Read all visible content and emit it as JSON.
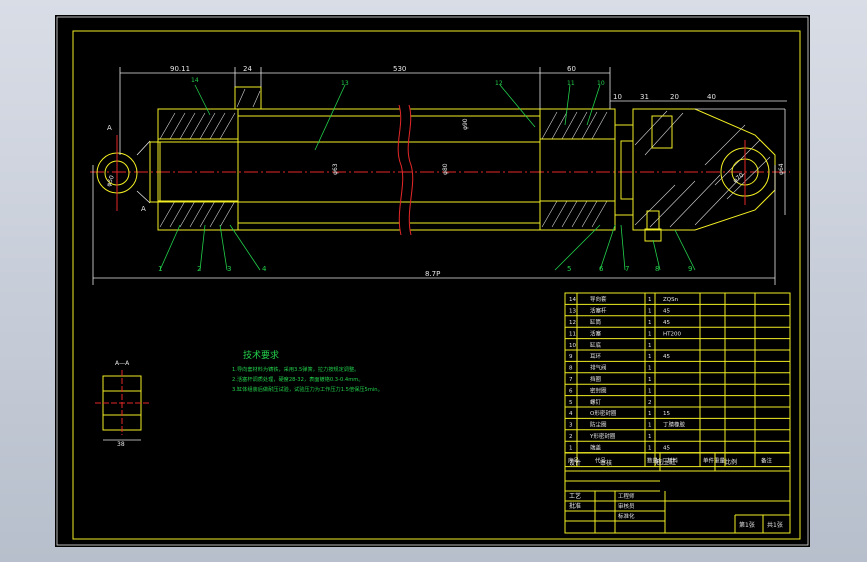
{
  "drawing": {
    "dimensions": {
      "d_90": "90.11",
      "d_24": "24",
      "d_530": "530",
      "d_60": "60",
      "d_10": "10",
      "d_31": "31",
      "d_20": "20",
      "d_40": "40",
      "d_total": "8.7P",
      "d_dia_left": "φ50",
      "d_dia_right": "φ70",
      "d_dia_rod": "φ63",
      "d_dia_bore": "φ80",
      "d_dia_out": "φ90",
      "d_38": "38",
      "d_A": "A",
      "d_side": "φ64"
    },
    "balloons_top": [
      "14",
      "13",
      "12",
      "11",
      "10"
    ],
    "balloons_bottom_left": [
      "1",
      "2",
      "3",
      "4"
    ],
    "balloons_bottom_right": [
      "5",
      "6",
      "7",
      "8",
      "9"
    ],
    "section_label": "A—A",
    "section_dim": "38"
  },
  "tech_requirements": {
    "title": "技术要求",
    "lines": [
      "1.导向套材料为铸铁，采用3.5弹簧，拉力按规定调整。",
      "2.活塞杆调质处理，硬度28-32，表面镀铬0.3-0.4mm。",
      "3.缸体组装后做耐压试验，试验压力为工作压力1.5倍保压5min。"
    ]
  },
  "parts_table": {
    "rows": [
      {
        "no": "14",
        "name": "导向套",
        "qty": "1",
        "mat": "ZQSn"
      },
      {
        "no": "13",
        "name": "活塞杆",
        "qty": "1",
        "mat": "45"
      },
      {
        "no": "12",
        "name": "缸筒",
        "qty": "1",
        "mat": "45"
      },
      {
        "no": "11",
        "name": "活塞",
        "qty": "1",
        "mat": "HT200"
      },
      {
        "no": "10",
        "name": "缸底",
        "qty": "1",
        "mat": ""
      },
      {
        "no": "9",
        "name": "耳环",
        "qty": "1",
        "mat": "45"
      },
      {
        "no": "8",
        "name": "排气阀",
        "qty": "1",
        "mat": ""
      },
      {
        "no": "7",
        "name": "挡圈",
        "qty": "1",
        "mat": ""
      },
      {
        "no": "6",
        "name": "密封圈",
        "qty": "1",
        "mat": ""
      },
      {
        "no": "5",
        "name": "螺钉",
        "qty": "2",
        "mat": ""
      },
      {
        "no": "4",
        "name": "O形密封圈",
        "qty": "1",
        "mat": "15"
      },
      {
        "no": "3",
        "name": "防尘圈",
        "qty": "1",
        "mat": "丁腈橡胶"
      },
      {
        "no": "2",
        "name": "Y形密封圈",
        "qty": "1",
        "mat": ""
      },
      {
        "no": "1",
        "name": "端盖",
        "qty": "1",
        "mat": "45"
      }
    ],
    "header": {
      "no": "序号",
      "name": "代号",
      "qty": "数量",
      "mat": "材料",
      "weight": "单件重量",
      "note": "备注"
    }
  },
  "title_block": {
    "drawing_name": "液压缸",
    "scale_label": "比例",
    "sheet_label": "共 张",
    "designer": "设计",
    "checker": "审核",
    "process": "工艺",
    "approve": "批准",
    "role1": "工程师",
    "role2": "审核员",
    "role3": "标准化",
    "page_a": "第1张",
    "page_b": "共1张"
  }
}
